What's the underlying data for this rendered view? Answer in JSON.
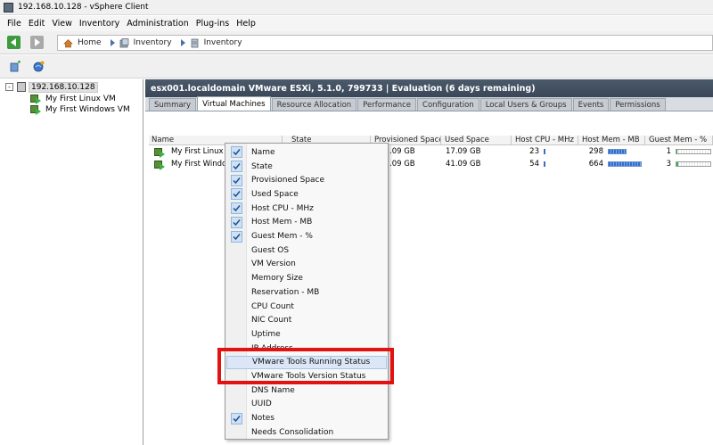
{
  "window": {
    "title": "192.168.10.128 - vSphere Client"
  },
  "menubar": {
    "items": [
      "File",
      "Edit",
      "View",
      "Inventory",
      "Administration",
      "Plug-ins",
      "Help"
    ]
  },
  "breadcrumb": {
    "items": [
      "Home",
      "Inventory",
      "Inventory"
    ]
  },
  "tree": {
    "host": "192.168.10.128",
    "expander": "-",
    "vms": [
      "My First Linux VM",
      "My First Windows VM"
    ]
  },
  "content": {
    "header": "esx001.localdomain VMware ESXi, 5.1.0, 799733  |  Evaluation (6 days remaining)",
    "tabs": [
      "Summary",
      "Virtual Machines",
      "Resource Allocation",
      "Performance",
      "Configuration",
      "Local Users & Groups",
      "Events",
      "Permissions"
    ],
    "active_tab": "Virtual Machines"
  },
  "grid": {
    "columns": [
      "Name",
      "State",
      "Provisioned Space",
      "Used Space",
      "Host CPU - MHz",
      "Host Mem - MB",
      "Guest Mem - %"
    ],
    "rows": [
      {
        "name": "My First Linux V",
        "prov": ".09 GB",
        "used": "17.09 GB",
        "cpu": "23",
        "mem": "298",
        "mem_ratio": 0.55,
        "guest": "1",
        "guest_ratio": 0.02
      },
      {
        "name": "My First Windo",
        "prov": ".09 GB",
        "used": "41.09 GB",
        "cpu": "54",
        "mem": "664",
        "mem_ratio": 1.0,
        "guest": "3",
        "guest_ratio": 0.05
      }
    ]
  },
  "context_menu": {
    "items": [
      {
        "label": "Name",
        "checked": true
      },
      {
        "label": "State",
        "checked": true
      },
      {
        "label": "Provisioned Space",
        "checked": true
      },
      {
        "label": "Used Space",
        "checked": true
      },
      {
        "label": "Host CPU - MHz",
        "checked": true
      },
      {
        "label": "Host Mem - MB",
        "checked": true
      },
      {
        "label": "Guest Mem - %",
        "checked": true
      },
      {
        "label": "Guest OS",
        "checked": false
      },
      {
        "label": "VM Version",
        "checked": false
      },
      {
        "label": "Memory Size",
        "checked": false
      },
      {
        "label": "Reservation - MB",
        "checked": false
      },
      {
        "label": "CPU Count",
        "checked": false
      },
      {
        "label": "NIC Count",
        "checked": false
      },
      {
        "label": "Uptime",
        "checked": false
      },
      {
        "label": "IP Address",
        "checked": false
      },
      {
        "label": "VMware Tools Running Status",
        "checked": false,
        "highlighted": true
      },
      {
        "label": "VMware Tools Version Status",
        "checked": false
      },
      {
        "label": "DNS Name",
        "checked": false
      },
      {
        "label": "UUID",
        "checked": false
      },
      {
        "label": "Notes",
        "checked": true
      },
      {
        "label": "Needs Consolidation",
        "checked": false
      }
    ]
  },
  "colors": {
    "annotation": "#e21212",
    "header_bg": "#3a4757"
  }
}
